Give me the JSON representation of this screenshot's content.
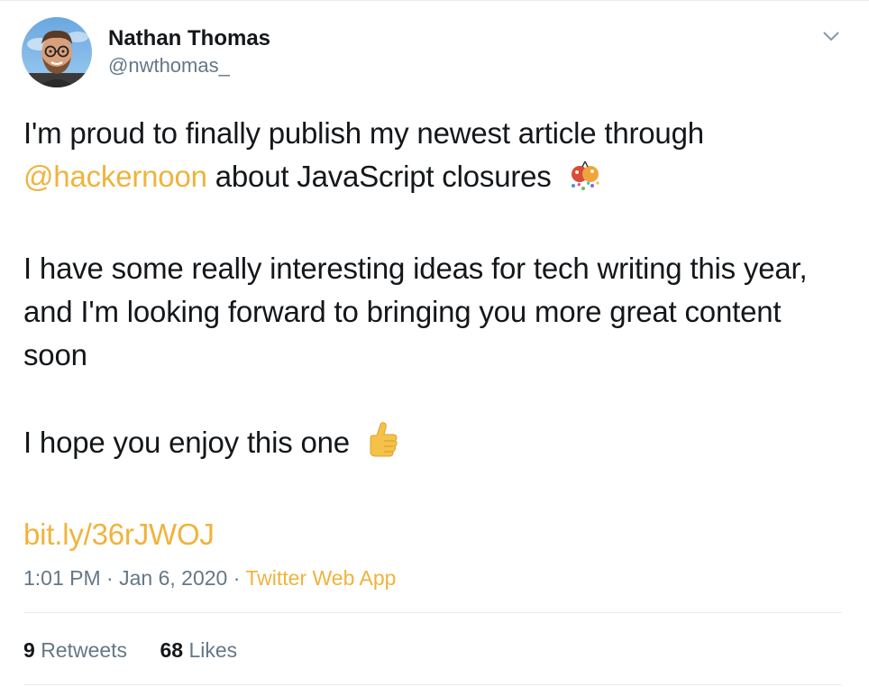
{
  "author": {
    "display_name": "Nathan Thomas",
    "handle": "@nwthomas_"
  },
  "tweet": {
    "line1": "I'm proud to finally publish my newest article through",
    "mention": "@hackernoon",
    "line2_rest": " about JavaScript closures",
    "paragraph2": "I have some really interesting ideas for tech writing this year, and I'm looking forward to bringing you more great content soon",
    "paragraph3": "I hope you enjoy this one",
    "link": "bit.ly/36rJWOJ"
  },
  "meta": {
    "time": "1:01 PM",
    "separator": " · ",
    "date": "Jan 6, 2020",
    "source": "Twitter Web App"
  },
  "stats": {
    "retweets_count": "9",
    "retweets_label": "Retweets",
    "likes_count": "68",
    "likes_label": "Likes"
  },
  "icons": {
    "menu": "chevron-down-icon",
    "emoji1": "party-popper-emoji",
    "emoji2": "thumbs-up-emoji"
  },
  "colors": {
    "accent": "#f0b33c",
    "text": "#14171a",
    "secondary": "#657786",
    "border": "#e6ecf0"
  }
}
